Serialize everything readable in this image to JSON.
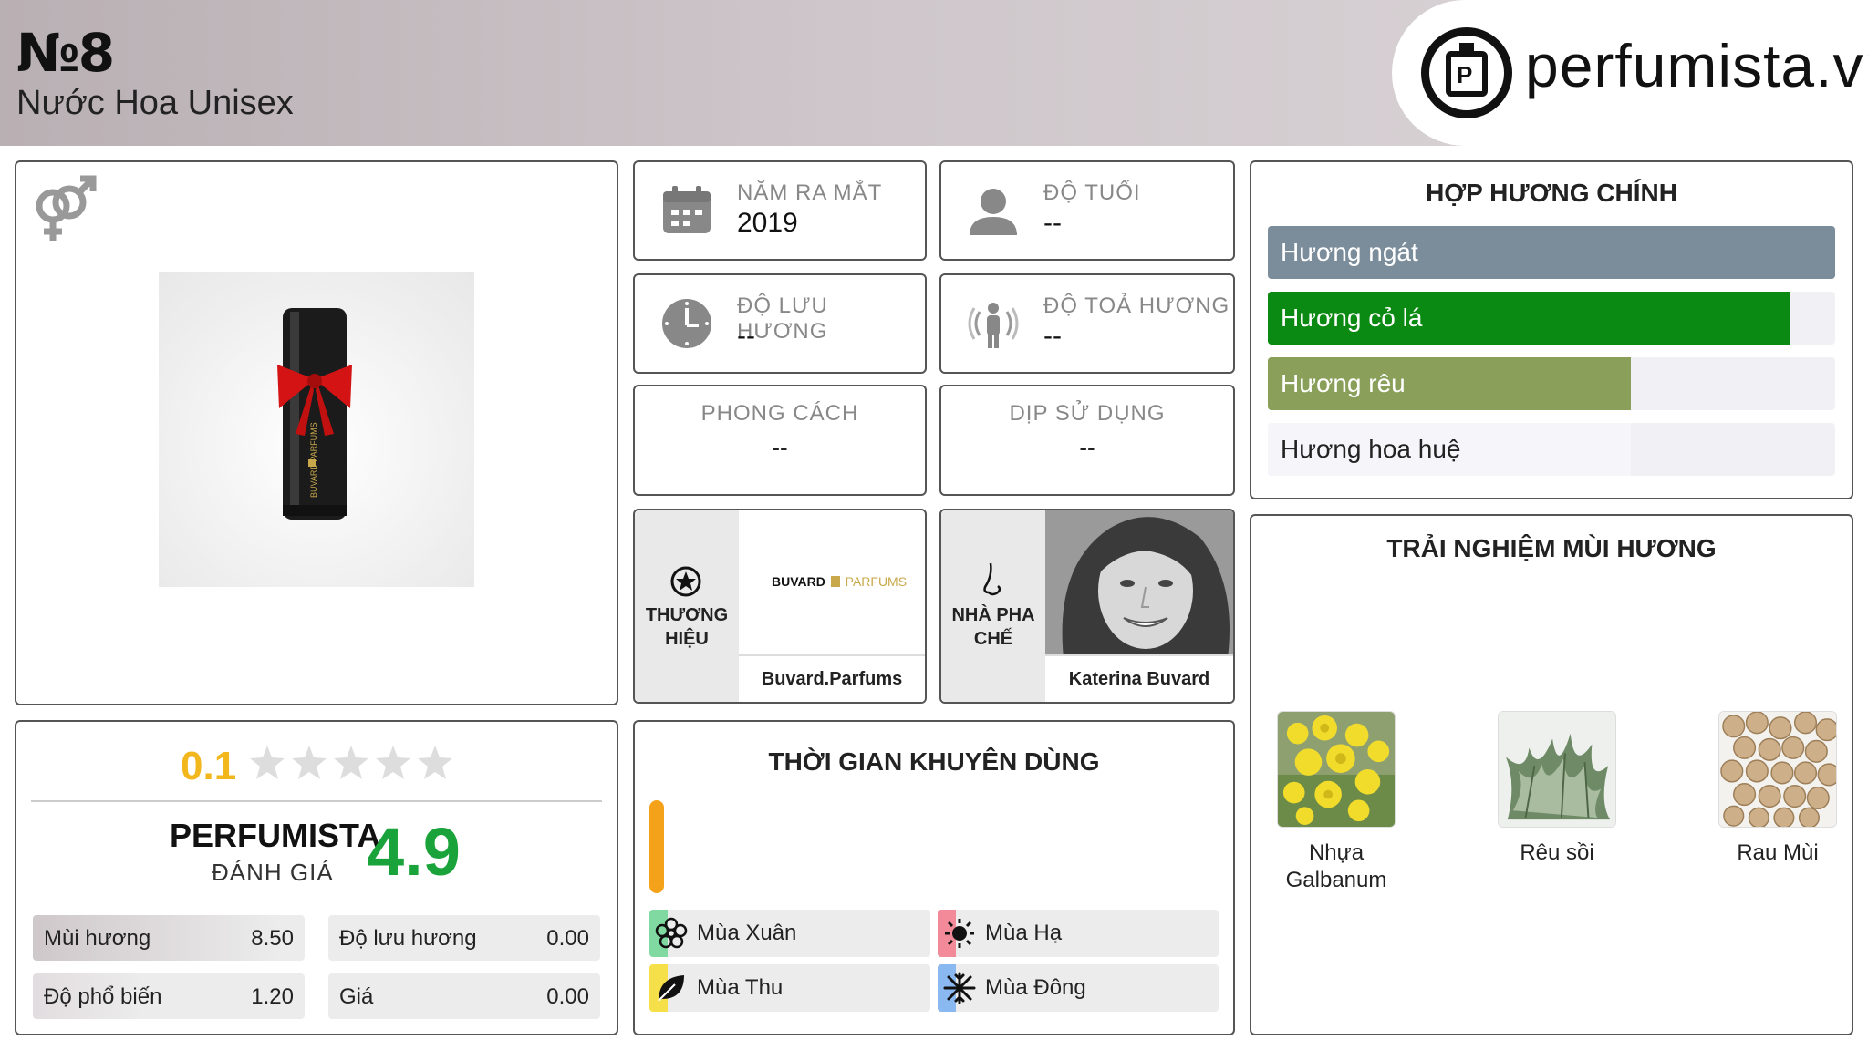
{
  "header": {
    "perfume_name": "№8",
    "perfume_type": "Nước Hoa Unisex",
    "logo_text": "perfumista.vn",
    "logo_glyph": "P"
  },
  "info": {
    "launch_year": {
      "label": "NĂM RA MẮT",
      "value": "2019"
    },
    "age": {
      "label": "ĐỘ TUỔI",
      "value": "--"
    },
    "longevity": {
      "label": "ĐỘ LƯU HƯƠNG",
      "value": "--"
    },
    "sillage": {
      "label": "ĐỘ TOẢ HƯƠNG",
      "value": "--"
    },
    "style": {
      "label": "PHONG CÁCH",
      "value": "--"
    },
    "occasion": {
      "label": "DỊP SỬ DỤNG",
      "value": "--"
    }
  },
  "brand": {
    "side_label_1": "THƯƠNG",
    "side_label_2": "HIỆU",
    "logo_text_1": "BUVARD",
    "logo_text_2": "PARFUMS",
    "name": "Buvard.Parfums"
  },
  "perfumer": {
    "side_label_1": "NHÀ PHA",
    "side_label_2": "CHẾ",
    "name": "Katerina Buvard"
  },
  "accords": {
    "title": "HỢP HƯƠNG CHÍNH",
    "items": [
      {
        "label": "Hương ngát",
        "color": "#7b8c9b",
        "level": 100,
        "text_color": "#ffffff"
      },
      {
        "label": "Hương cỏ lá",
        "color": "#0a8a12",
        "level": 92,
        "text_color": "#ffffff"
      },
      {
        "label": "Hương rêu",
        "color": "#8aa05a",
        "level": 64,
        "text_color": "#ffffff"
      },
      {
        "label": "Hương hoa huệ",
        "color": "#f5f5fa",
        "level": 64,
        "text_color": "#222222"
      }
    ]
  },
  "notes": {
    "title": "TRẢI NGHIỆM MÙI HƯƠNG",
    "items": [
      {
        "label": "Nhựa Galbanum"
      },
      {
        "label": "Rêu sồi"
      },
      {
        "label": "Rau Mùi"
      }
    ]
  },
  "rating": {
    "small_score": "0.1",
    "stars_filled": 0,
    "stars_total": 5,
    "brand_label": "PERFUMISTA",
    "sub_label": "ĐÁNH GIÁ",
    "score": "4.9",
    "metrics": [
      {
        "label": "Mùi hương",
        "value": "8.50"
      },
      {
        "label": "Độ lưu hương",
        "value": "0.00"
      },
      {
        "label": "Độ phổ biến",
        "value": "1.20"
      },
      {
        "label": "Giá",
        "value": "0.00"
      }
    ]
  },
  "usage": {
    "title": "THỜI GIAN KHUYÊN DÙNG",
    "seasons": [
      {
        "name": "Mùa Xuân",
        "color": "#7fd9a0",
        "icon": "flower-icon"
      },
      {
        "name": "Mùa Hạ",
        "color": "#f28a9a",
        "icon": "sun-icon"
      },
      {
        "name": "Mùa Thu",
        "color": "#f5e04a",
        "icon": "leaf-icon"
      },
      {
        "name": "Mùa Đông",
        "color": "#8ab8f0",
        "icon": "snowflake-icon"
      }
    ]
  },
  "colors": {
    "score_green": "#1aa33a",
    "score_yellow": "#f1b71c",
    "panel_border": "#555555"
  }
}
